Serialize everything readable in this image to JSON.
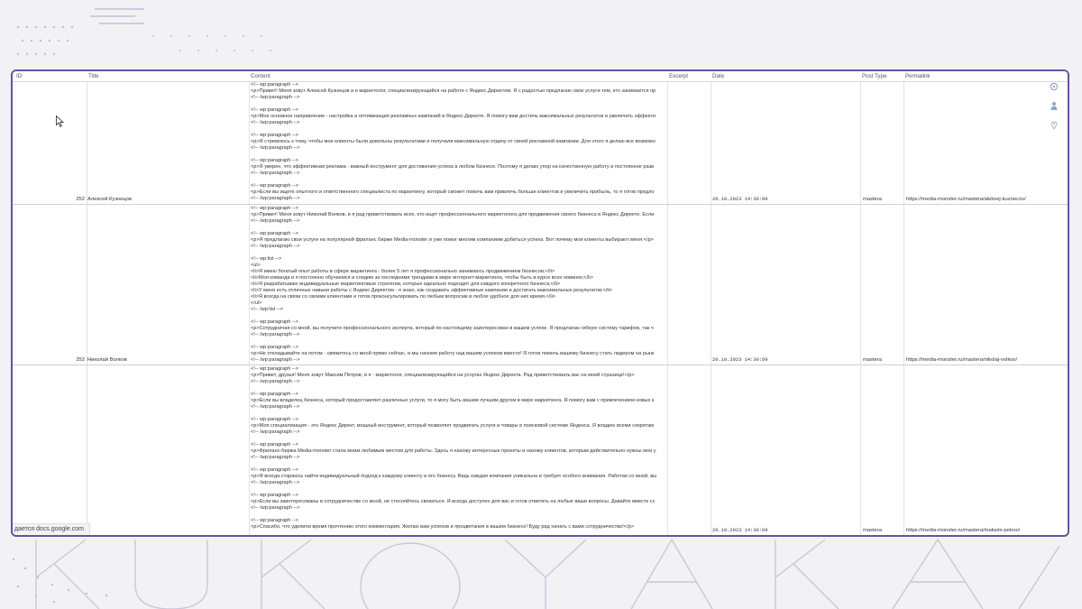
{
  "table": {
    "headers": [
      "ID",
      "Title",
      "Content",
      "Excerpt",
      "Date",
      "Post Type",
      "Permalink"
    ],
    "rows": [
      {
        "id": "252",
        "title": "Алексей Кузнецов",
        "content": [
          "<!-- wp:paragraph -->",
          "<p>Привет! Меня зовут Алексей Кузнецов и я маркетолог, специализирующийся на работе с Яндекс.Директом. Я с радостью предлагаю свои услуги тем, кто занимается пр",
          "<!-- /wp:paragraph -->",
          "",
          "<!-- wp:paragraph -->",
          "<p>Мое основное направление - настройка и оптимизация рекламных кампаний в Яндекс.Директе. Я помогу вам достичь максимальных результатов и увеличить эффекти",
          "<!-- /wp:paragraph -->",
          "",
          "<!-- wp:paragraph -->",
          "<p>Я стремлюсь к тому, чтобы мои клиенты были довольны результатами и получали максимальную отдачу от своей рекламной кампании. Для этого я делаю все возможн",
          "<!-- /wp:paragraph -->",
          "",
          "<!-- wp:paragraph -->",
          "<p>Я уверен, что эффективная реклама - важный инструмент для достижения успеха в любом бизнесе. Поэтому я делаю упор на качественную работу и постоянное разв",
          "<!-- /wp:paragraph -->",
          "",
          "<!-- wp:paragraph -->",
          "<p>Если вы ищете опытного и ответственного специалиста по маркетингу, который сможет помочь вам привлечь больше клиентов и увеличить прибыль, то я готов предло",
          "<!-- /wp:paragraph -->"
        ],
        "excerpt": "",
        "date": "20.10.2023 14:30:09",
        "post_type": "mastera",
        "permalink": "https://media-monster.ru/mastera/aleksej-kuznecov/"
      },
      {
        "id": "252",
        "title": "Николай Волков",
        "content": [
          "<!-- wp:paragraph -->",
          "<p>Привет! Меня зовут Николай Волков, и я рад приветствовать всех, кто ищет профессионального маркетолога для продвижения своего бизнеса в Яндекс Директе. Если",
          "<!-- /wp:paragraph -->",
          "",
          "<!-- wp:paragraph -->",
          "<p>Я предлагаю свои услуги на популярной фриланс бирже Media-monster и уже помог многим компаниям добиться успеха. Вот почему мои клиенты выбирают меня:</p>",
          "<!-- /wp:paragraph -->",
          "",
          "<!-- wp:list -->",
          "<ul>",
          "<li>Я имею богатый опыт работы в сфере маркетинга - более 5 лет я профессионально занимаюсь продвижением бизнесов;</li>",
          "<li>Моя команда и я постоянно обучаемся и следим за последними трендами в мире интернет-маркетинга, чтобы быть в курсе всех новинок;</li>",
          "<li>Я разрабатываю индивидуальные маркетинговые стратегии, которые идеально подходят для каждого конкретного бизнеса;</li>",
          "<li>У меня есть отличные навыки работы с Яндекс Директом - я знаю, как создавать эффективные кампании и достигать максимальных результатов;</li>",
          "<li>Я всегда на связи со своими клиентами и готов проконсультировать по любым вопросам в любое удобное для них время.</li>",
          "</ul>",
          "<!-- /wp:list -->",
          "",
          "<!-- wp:paragraph -->",
          "<p>Сотрудничая со мной, вы получите профессионального эксперта, который по-настоящему заинтересован в вашем успехе. Я предлагаю гибкую систему тарифов, так ч",
          "<!-- /wp:paragraph -->",
          "",
          "<!-- wp:paragraph -->",
          "<p>Не откладывайте на потом - свяжитесь со мной прямо сейчас, и мы начнем работу над вашим успехом вместе! Я готов помочь вашему бизнесу стать лидером на рынк",
          "<!-- /wp:paragraph -->"
        ],
        "excerpt": "",
        "date": "20.10.2023 14:30:09",
        "post_type": "mastera",
        "permalink": "https://media-monster.ru/mastera/nikolaj-volkov/"
      },
      {
        "id": "",
        "title": "",
        "content": [
          "<!-- wp:paragraph -->",
          "<p>Привет, друзья! Меня зовут Максим Петров, и я - маркетолог, специализирующийся на услугах Яндекс Директа. Рад приветствовать вас на моей странице!</p>",
          "<!-- /wp:paragraph -->",
          "",
          "<!-- wp:paragraph -->",
          "<p>Если вы владелец бизнеса, который предоставляет различные услуги, то я могу быть вашим лучшим другом в мире маркетинга. Я помогу вам с привлечением новых к",
          "<!-- /wp:paragraph -->",
          "",
          "<!-- wp:paragraph -->",
          "<p>Моя специализация - это Яндекс Директ, мощный инструмент, который позволяет продвигать услуги и товары в поисковой системе Яндекса. Я владею всеми секретам",
          "<!-- /wp:paragraph -->",
          "",
          "<!-- wp:paragraph -->",
          "<p>Фриланс-биржа Media-monster стала моим любимым местом для работы. Здесь я нахожу интересные проекты и нахожу клиентов, которым действительно нужны мои у",
          "<!-- /wp:paragraph -->",
          "",
          "<!-- wp:paragraph -->",
          "<p>Я всегда стараюсь найти индивидуальный подход к каждому клиенту и его бизнесу. Ведь каждая компания уникальна и требует особого внимания. Работая со мной, вы",
          "<!-- /wp:paragraph -->",
          "",
          "<!-- wp:paragraph -->",
          "<p>Если вы заинтересованы в сотрудничестве со мной, не стесняйтесь связаться. Я всегда доступен для вас и готов ответить на любые ваши вопросы. Давайте вместе сс",
          "<!-- /wp:paragraph -->",
          "",
          "<!-- wp:paragraph -->",
          "<p>Спасибо, что уделили время прочтению этого комментария. Желаю вам успехов и процветания в вашем бизнесе! Буду рад начать с вами сотрудничество!</p>"
        ],
        "excerpt": "",
        "date": "20.10.2023 14:30:09",
        "post_type": "mastera",
        "permalink": "https://media-monster.ru/mastera/maksim-petrov/"
      }
    ]
  },
  "status_bar": {
    "text": "дается docs.google.com"
  },
  "side_icons": [
    "gear-icon",
    "user-icon",
    "location-pin-icon"
  ],
  "background": {
    "watermark": "KUKOYAKA"
  },
  "colors": {
    "frame": "#6b4fa3",
    "background": "#f2f2f4",
    "icon": "#8fa6cf"
  }
}
